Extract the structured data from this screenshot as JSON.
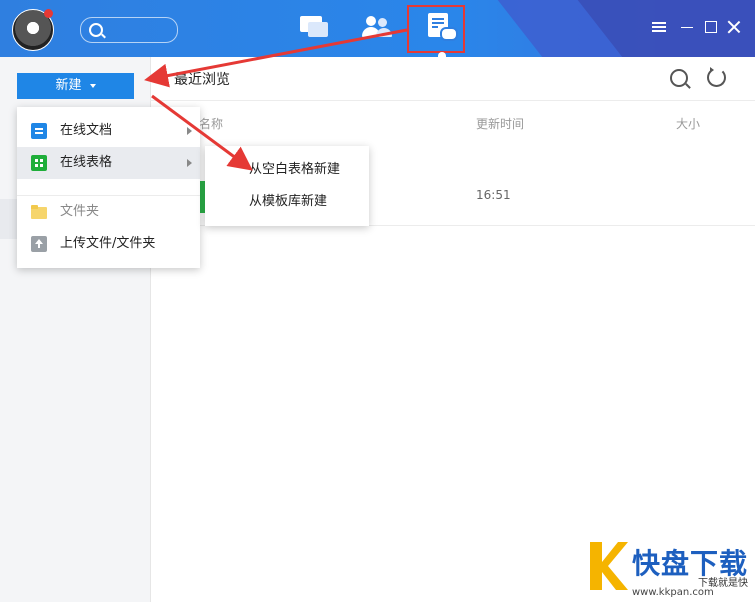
{
  "header": {
    "nav": [
      "chat",
      "contacts",
      "docs"
    ],
    "active_tab": "docs"
  },
  "sidebar": {
    "new_button": "新建"
  },
  "main": {
    "title": "最近浏览",
    "columns": {
      "name": "名称",
      "updated": "更新时间",
      "size": "大小"
    },
    "rows": [
      {
        "updated": "16:51"
      }
    ]
  },
  "new_menu": {
    "items": [
      {
        "label": "在线文档",
        "icon": "doc-icon"
      },
      {
        "label": "在线表格",
        "icon": "sheet-icon"
      },
      {
        "label": "文件夹",
        "icon": "folder-icon"
      },
      {
        "label": "上传文件/文件夹",
        "icon": "upload-icon"
      }
    ]
  },
  "sheet_submenu": {
    "items": [
      {
        "label": "从空白表格新建"
      },
      {
        "label": "从模板库新建"
      }
    ]
  },
  "watermark": {
    "title": "快盘下载",
    "subtitle": "下载就是快",
    "url": "www.kkpan.com"
  },
  "colors": {
    "titlebar": "#2f7fe0",
    "accent": "#1f86e6",
    "annotation": "#e53935",
    "sheet_green": "#1fae3a"
  }
}
